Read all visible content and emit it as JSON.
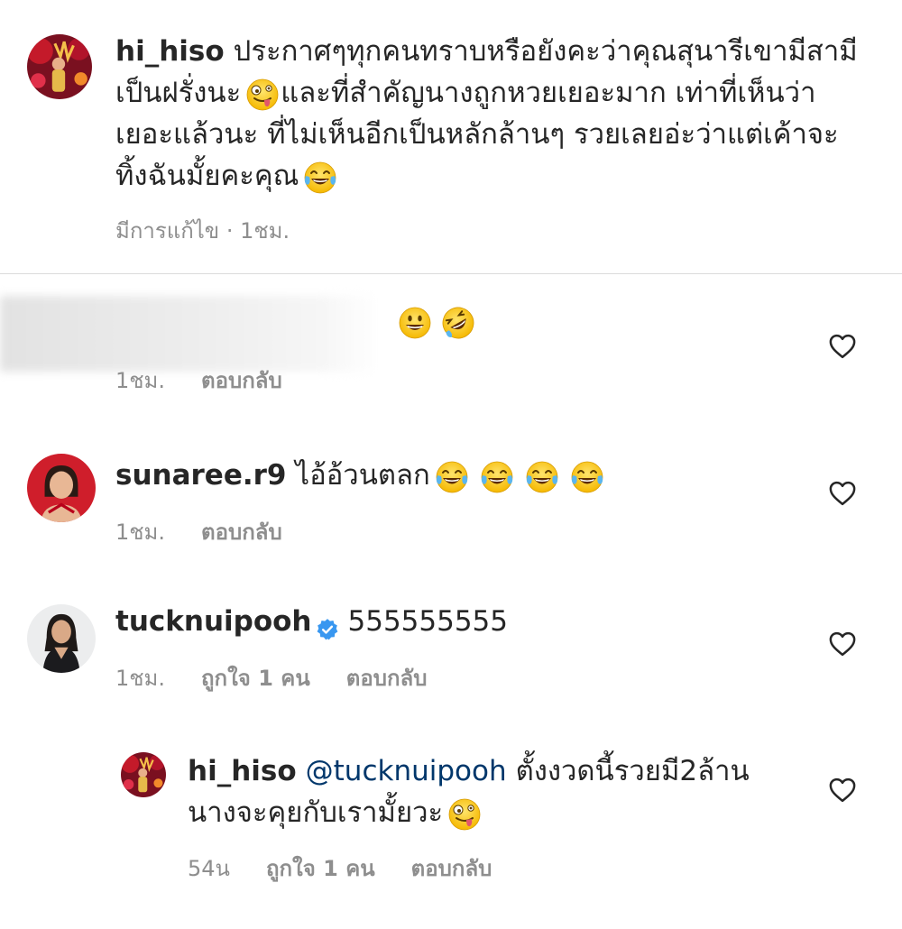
{
  "caption": {
    "username": "hi_hiso",
    "lines": [
      "ประกาศๆทุกคนทราบหรือยังคะว่าคุณสุนารีเขามีสามี",
      "เป็นฝรั่งนะ",
      "และที่สำคัญนางถูกหวยเยอะมาก เท่าที่เห็นว่า",
      "เยอะแล้วนะ ที่ไม่เห็นอีกเป็นหลักล้านๆ รวยเลยอ่ะว่าแต่เค้าจะ",
      "ทิ้งฉันมั้ยคะคุณ"
    ],
    "edited": "มีการแก้ไข · 1ชม."
  },
  "comments": [
    {
      "username": "",
      "text": "",
      "time": "1ชม.",
      "reply_label": "ตอบกลับ",
      "icons": [
        "grinning-emoji",
        "rofl-emoji"
      ]
    },
    {
      "username": "sunaree.r9",
      "text": "ไอ้อ้วนตลก",
      "time": "1ชม.",
      "reply_label": "ตอบกลับ",
      "icons": [
        "tears-of-joy-emoji",
        "tears-of-joy-emoji",
        "tears-of-joy-emoji",
        "tears-of-joy-emoji"
      ]
    },
    {
      "username": "tucknuipooh",
      "text": "555555555",
      "time": "1ชม.",
      "likes": "ถูกใจ 1 คน",
      "reply_label": "ตอบกลับ",
      "verified": true
    }
  ],
  "reply": {
    "username": "hi_hiso",
    "mention": "@tucknuipooh",
    "line1": "ตั้งงวดนี้รวยมี2ล้าน",
    "line2": "นางจะคุยกับเรามั้ยวะ",
    "time": "54น",
    "likes": "ถูกใจ 1 คน",
    "reply_label": "ตอบกลับ"
  },
  "colors": {
    "text": "#262626",
    "meta": "#8e8e8e",
    "mention": "#00376b",
    "verified": "#3897f0",
    "divider": "#dbdbdb"
  }
}
